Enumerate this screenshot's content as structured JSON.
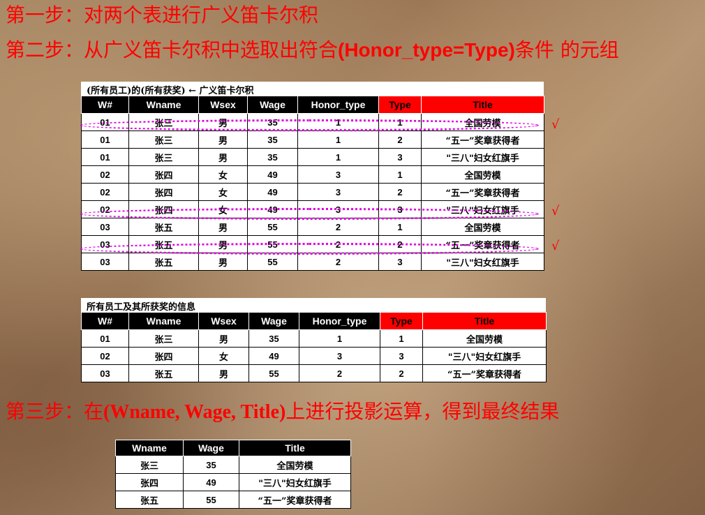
{
  "steps": {
    "step1": "第一步：对两个表进行广义笛卡尔积",
    "step2_prefix": "第二步：从广义笛卡尔积中选取出符合",
    "step2_cond": "(Honor_type=Type)",
    "step2_suffix": "条件 的元组",
    "step3_prefix": "第三步：在",
    "step3_cond": "(Wname, Wage, Title)",
    "step3_suffix": "上进行投影运算，得到最终结果"
  },
  "table1": {
    "caption": "(所有员工)的(所有获奖)  ←  广义笛卡尔积",
    "headers": [
      "W#",
      "Wname",
      "Wsex",
      "Wage",
      "Honor_type",
      "Type",
      "Title"
    ],
    "rows": [
      [
        "01",
        "张三",
        "男",
        "35",
        "1",
        "1",
        "全国劳模"
      ],
      [
        "01",
        "张三",
        "男",
        "35",
        "1",
        "2",
        "“五一”奖章获得者"
      ],
      [
        "01",
        "张三",
        "男",
        "35",
        "1",
        "3",
        "\"三八\"妇女红旗手"
      ],
      [
        "02",
        "张四",
        "女",
        "49",
        "3",
        "1",
        "全国劳模"
      ],
      [
        "02",
        "张四",
        "女",
        "49",
        "3",
        "2",
        "“五一”奖章获得者"
      ],
      [
        "02",
        "张四",
        "女",
        "49",
        "3",
        "3",
        "\"三八\"妇女红旗手"
      ],
      [
        "03",
        "张五",
        "男",
        "55",
        "2",
        "1",
        "全国劳模"
      ],
      [
        "03",
        "张五",
        "男",
        "55",
        "2",
        "2",
        "“五一”奖章获得者"
      ],
      [
        "03",
        "张五",
        "男",
        "55",
        "2",
        "3",
        "\"三八\"妇女红旗手"
      ]
    ],
    "check_mark": "√"
  },
  "table2": {
    "caption": "所有员工及其所获奖的信息",
    "headers": [
      "W#",
      "Wname",
      "Wsex",
      "Wage",
      "Honor_type",
      "Type",
      "Title"
    ],
    "rows": [
      [
        "01",
        "张三",
        "男",
        "35",
        "1",
        "1",
        "全国劳模"
      ],
      [
        "02",
        "张四",
        "女",
        "49",
        "3",
        "3",
        "\"三八\"妇女红旗手"
      ],
      [
        "03",
        "张五",
        "男",
        "55",
        "2",
        "2",
        "“五一”奖章获得者"
      ]
    ]
  },
  "table3": {
    "headers": [
      "Wname",
      "Wage",
      "Title"
    ],
    "rows": [
      [
        "张三",
        "35",
        "全国劳模"
      ],
      [
        "张四",
        "49",
        "\"三八\"妇女红旗手"
      ],
      [
        "张五",
        "55",
        "“五一”奖章获得者"
      ]
    ]
  }
}
